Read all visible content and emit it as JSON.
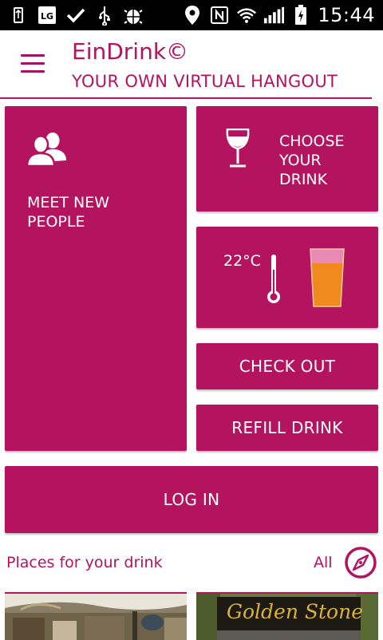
{
  "status_bar": {
    "time": "15:44",
    "left_icons": [
      "usb-icon",
      "lg-icon",
      "check-icon",
      "usb-icon",
      "android-debug-icon"
    ],
    "right_icons": [
      "location-icon",
      "nfc-icon",
      "wifi-icon",
      "signal-icon",
      "battery-charging-icon"
    ]
  },
  "header": {
    "title": "EinDrink©",
    "subtitle": "YOUR OWN VIRTUAL HANGOUT",
    "menu_icon": "hamburger-menu-icon"
  },
  "tiles": {
    "meet": {
      "label": "MEET NEW PEOPLE",
      "icon": "people-icon"
    },
    "choose": {
      "label": "CHOOSE YOUR DRINK",
      "icon": "wine-glass-icon"
    },
    "temperature": {
      "value": "22°C",
      "icons": [
        "thermometer-icon",
        "beer-glass-icon"
      ]
    },
    "checkout": {
      "label": "CHECK OUT"
    },
    "refill": {
      "label": "REFILL DRINK"
    },
    "login": {
      "label": "LOG IN"
    }
  },
  "places": {
    "title": "Places for your drink",
    "all_label": "All",
    "compass_icon": "compass-icon",
    "cards": [
      {
        "image": "outdoor-terrace-photo"
      },
      {
        "name": "Golden Stone",
        "image": "golden-stone-sign-photo"
      }
    ]
  },
  "colors": {
    "accent": "#b4145f",
    "status_bar": "#000000",
    "background": "#ffffff",
    "beer": "#f08a1e",
    "beer_foam": "#e98ab5",
    "sign_text": "#d8b23a"
  }
}
